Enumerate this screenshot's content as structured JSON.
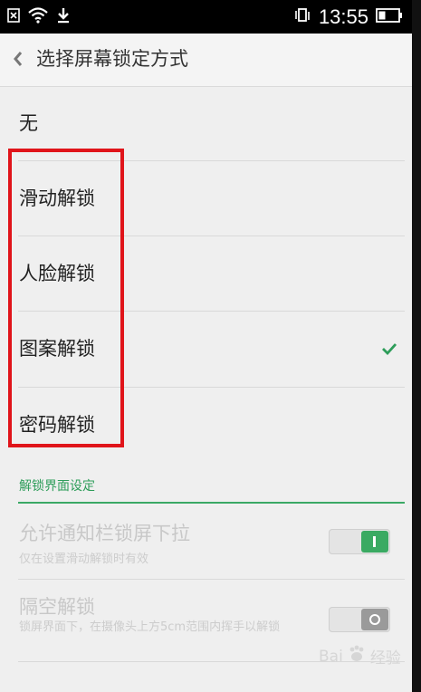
{
  "status_bar": {
    "time": "13:55",
    "left_icons": [
      "close-box-icon",
      "wifi-icon",
      "download-icon"
    ],
    "right_icons": [
      "screen-rotate-icon",
      "battery-icon"
    ]
  },
  "header": {
    "title": "选择屏幕锁定方式",
    "back_icon": "chevron-left-icon"
  },
  "lock_options": [
    {
      "label": "无",
      "selected": false
    },
    {
      "label": "滑动解锁",
      "selected": false
    },
    {
      "label": "人脸解锁",
      "selected": false
    },
    {
      "label": "图案解锁",
      "selected": true
    },
    {
      "label": "密码解锁",
      "selected": false
    }
  ],
  "section": {
    "title": "解锁界面设定"
  },
  "settings": [
    {
      "title": "允许通知栏锁屏下拉",
      "desc": "仅在设置滑动解锁时有效",
      "enabled": false,
      "toggle_on": true
    },
    {
      "title": "隔空解锁",
      "desc": "锁屏界面下，在摄像头上方5cm范围内挥手以解锁",
      "enabled": false,
      "toggle_on": false
    }
  ],
  "watermark": {
    "text": "Bai",
    "suffix": "经验"
  },
  "colors": {
    "accent": "#3aa865",
    "highlight": "#e0141a",
    "background": "#efefef"
  }
}
